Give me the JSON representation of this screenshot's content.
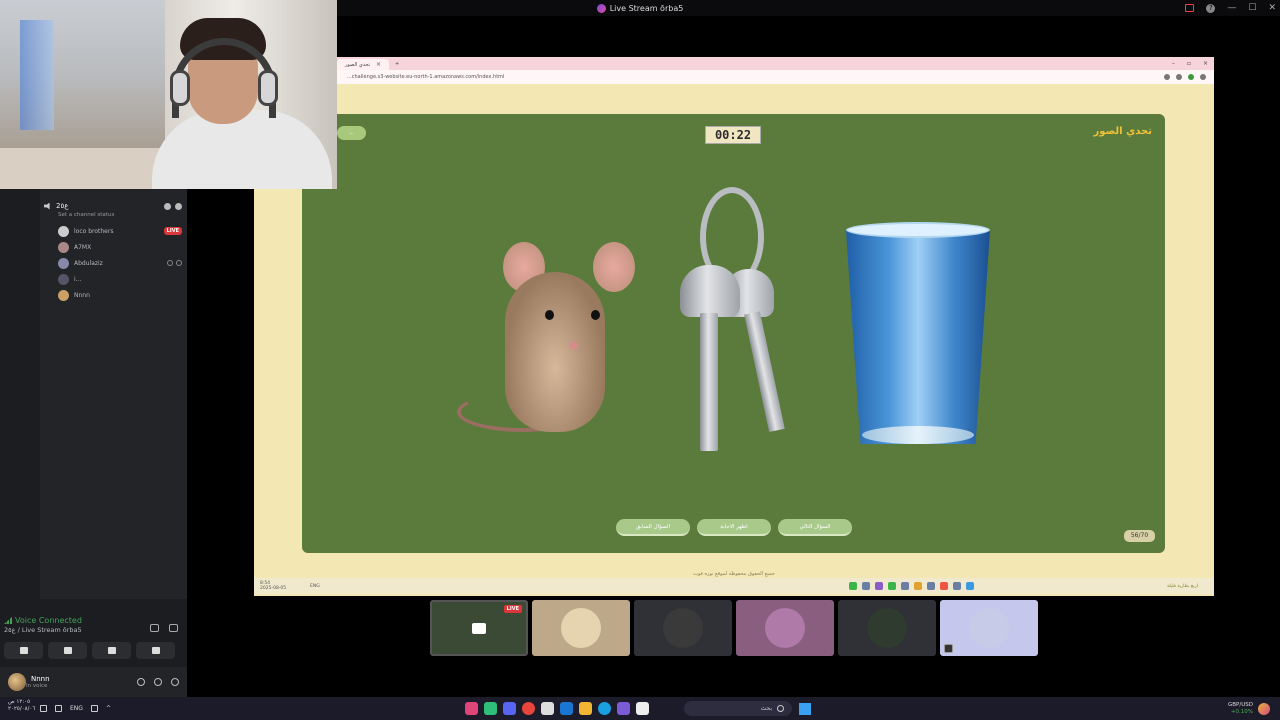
{
  "window": {
    "title": "Live Stream ōrba5",
    "accent": "#7b4bd9"
  },
  "browser": {
    "tab_title": "تحدي الصور",
    "url": "...challenge.s3-website.eu-north-1.amazonaws.com/index.html"
  },
  "game": {
    "title": "تحدي الصور",
    "timer": "00:22",
    "counter": "56/70",
    "left_pill": "...",
    "buttons": {
      "previous": "السؤال السابق",
      "show_answer": "اظهر الاجابة",
      "next": "السؤال التالي"
    },
    "footer": "جميع الحقوق محفوظة لموقع نوره فوت",
    "images": [
      "mouse",
      "keys",
      "glass-of-water"
    ],
    "board_color": "#5a7b3b",
    "title_color": "#f0c23b"
  },
  "sidebar": {
    "channel": {
      "name": "2ع٥",
      "status": "Set a channel status"
    },
    "members": [
      {
        "name": "loco brothers",
        "badge": "LIVE"
      },
      {
        "name": "A7MX"
      },
      {
        "name": "Abdulaziz"
      },
      {
        "name": "i..."
      },
      {
        "name": "Nnnn"
      }
    ]
  },
  "voice": {
    "status": "Voice Connected",
    "channel": "2ع٥ / Live Stream ōrba5",
    "status_color": "#43a25a"
  },
  "user": {
    "name": "Nnnn",
    "status": "In voice"
  },
  "thumbnails": {
    "live_badge": "LIVE",
    "faces": [
      "#e6d4b0",
      "#3a3a3a",
      "#b07aa8",
      "#2e3b2e",
      "#c8cbe8"
    ]
  },
  "inner_taskbar": {
    "time": "8:54",
    "date": "2025-08-05",
    "lang": "ENG",
    "right_note": "اربع بطارية قليلة"
  },
  "taskbar": {
    "time": "١٢:٠٥ ص",
    "date": "٢٠٢٥/٠٨/٠٦",
    "lang": "ENG",
    "search_placeholder": "بحث",
    "fx_pair": "GBP/USD",
    "fx_change": "+0.10%"
  }
}
